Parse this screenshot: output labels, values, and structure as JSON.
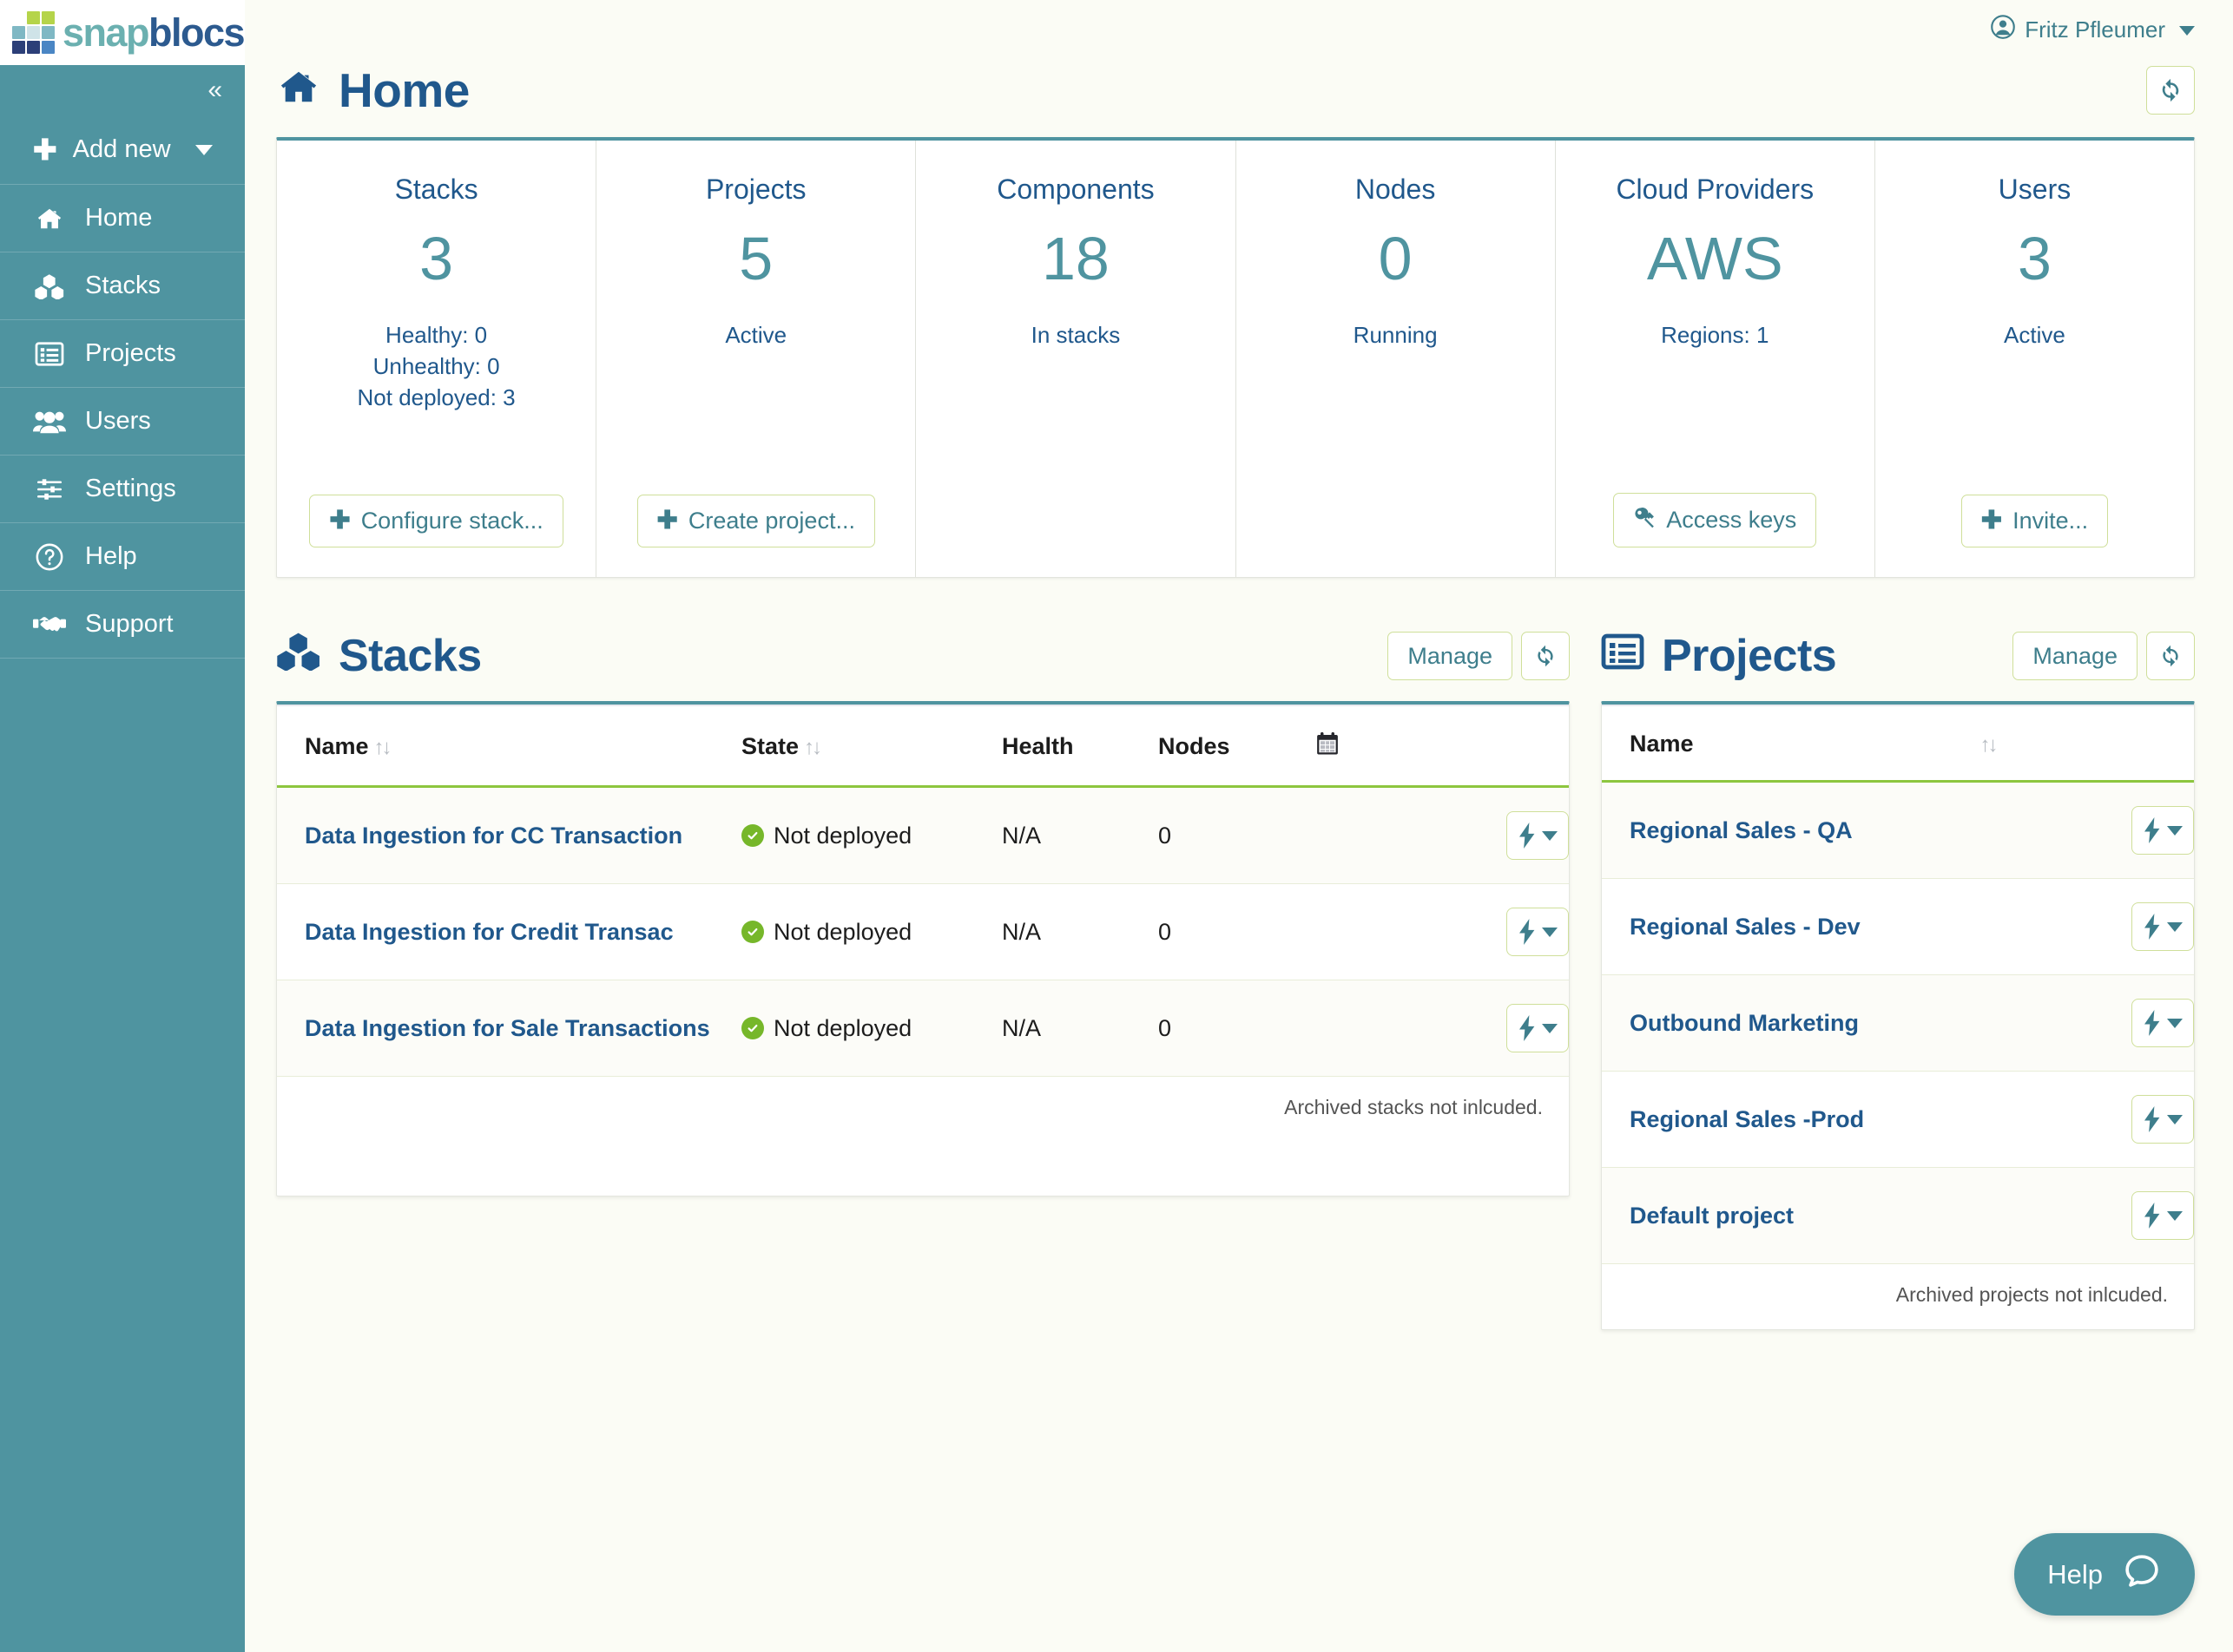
{
  "brand": {
    "name_part1": "snap",
    "name_part2": "blocs"
  },
  "sidebar": {
    "collapse_label": "«",
    "add_new_label": "Add new",
    "items": [
      {
        "label": "Home",
        "icon": "home-icon"
      },
      {
        "label": "Stacks",
        "icon": "stacks-icon"
      },
      {
        "label": "Projects",
        "icon": "projects-icon"
      },
      {
        "label": "Users",
        "icon": "users-icon"
      },
      {
        "label": "Settings",
        "icon": "settings-icon"
      },
      {
        "label": "Help",
        "icon": "help-circle-icon"
      },
      {
        "label": "Support",
        "icon": "handshake-icon"
      }
    ]
  },
  "topbar": {
    "user_name": "Fritz Pfleumer"
  },
  "page": {
    "title": "Home",
    "refresh_label": "refresh"
  },
  "cards": [
    {
      "title": "Stacks",
      "value": "3",
      "sub": "Healthy: 0\nUnhealthy: 0\nNot deployed: 3",
      "button": "Configure stack...",
      "button_icon": "plus-icon"
    },
    {
      "title": "Projects",
      "value": "5",
      "sub": "Active",
      "button": "Create project...",
      "button_icon": "plus-icon"
    },
    {
      "title": "Components",
      "value": "18",
      "sub": "In stacks",
      "button": "",
      "button_icon": ""
    },
    {
      "title": "Nodes",
      "value": "0",
      "sub": "Running",
      "button": "",
      "button_icon": ""
    },
    {
      "title": "Cloud Providers",
      "value": "AWS",
      "sub": "Regions: 1",
      "button": "Access keys",
      "button_icon": "key-icon"
    },
    {
      "title": "Users",
      "value": "3",
      "sub": "Active",
      "button": "Invite...",
      "button_icon": "plus-icon"
    }
  ],
  "stacks_panel": {
    "title": "Stacks",
    "manage_label": "Manage",
    "columns": {
      "name": "Name",
      "state": "State",
      "health": "Health",
      "nodes": "Nodes",
      "schedule": "calendar-icon"
    },
    "rows": [
      {
        "name": "Data Ingestion for CC Transaction",
        "state": "Not deployed",
        "health": "N/A",
        "nodes": "0"
      },
      {
        "name": "Data Ingestion for Credit Transac",
        "state": "Not deployed",
        "health": "N/A",
        "nodes": "0"
      },
      {
        "name": "Data Ingestion for Sale Transactions",
        "state": "Not deployed",
        "health": "N/A",
        "nodes": "0"
      }
    ],
    "footnote": "Archived stacks not inlcuded."
  },
  "projects_panel": {
    "title": "Projects",
    "manage_label": "Manage",
    "columns": {
      "name": "Name"
    },
    "rows": [
      {
        "name": "Regional Sales - QA"
      },
      {
        "name": "Regional Sales - Dev"
      },
      {
        "name": "Outbound Marketing"
      },
      {
        "name": "Regional Sales -Prod"
      },
      {
        "name": "Default project"
      }
    ],
    "footnote": "Archived projects not inlcuded."
  },
  "help_widget": {
    "label": "Help"
  },
  "colors": {
    "sidebar_bg": "#4f94a0",
    "accent_teal": "#4f94a0",
    "heading_blue": "#20588c",
    "border_green": "#cfdf9a",
    "status_green": "#76b72a",
    "page_bg": "#fbfcf5"
  }
}
